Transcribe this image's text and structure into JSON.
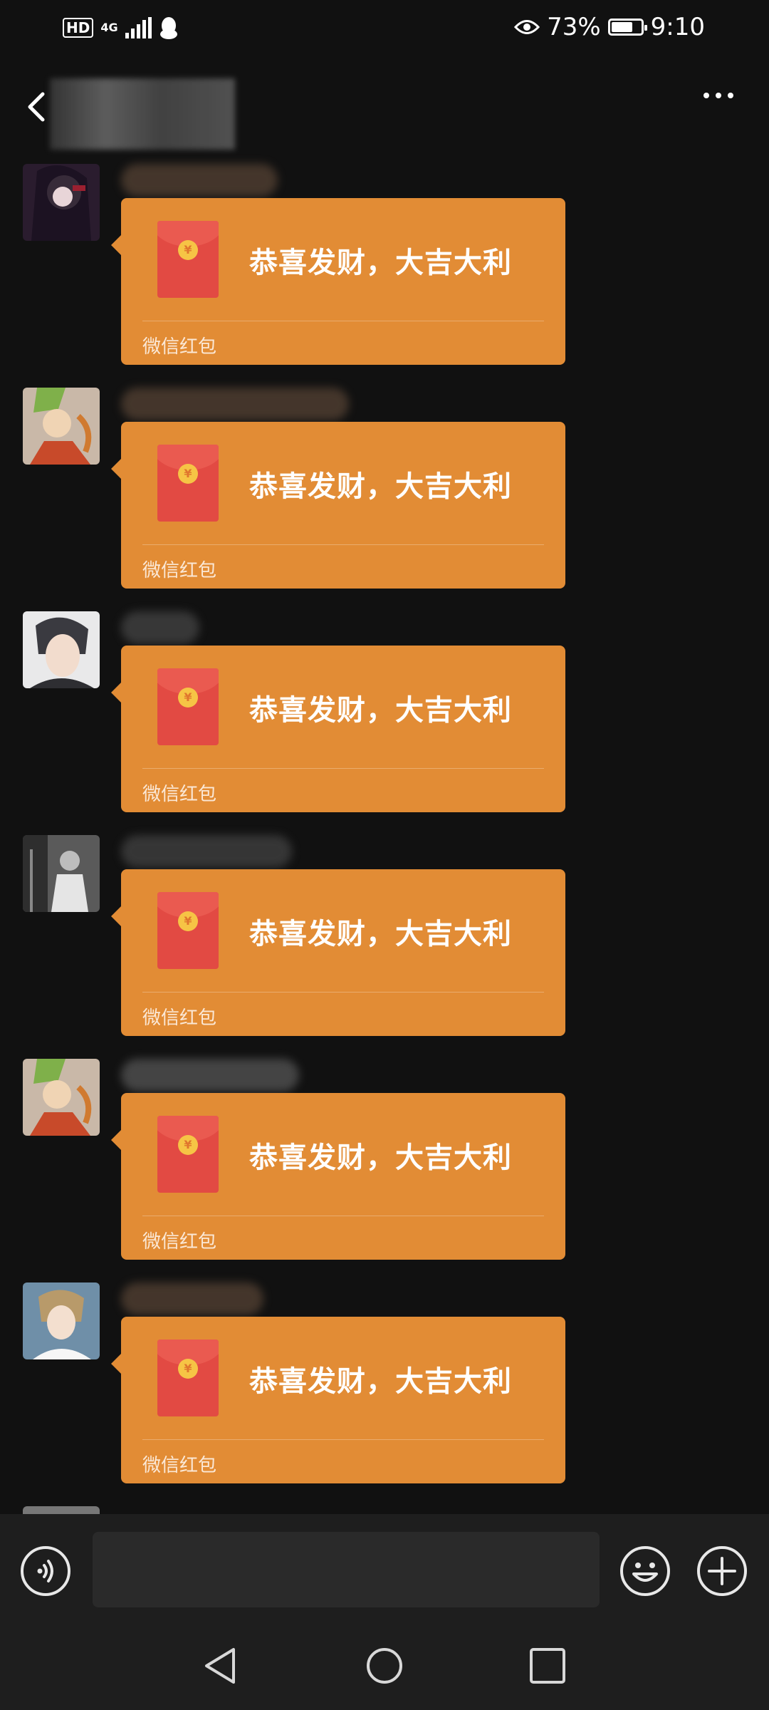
{
  "status_bar": {
    "hd": "HD",
    "network": "4G",
    "battery_percent": "73%",
    "battery_level": 0.73,
    "time": "9:10",
    "icons": [
      "hd-icon",
      "signal-icon",
      "qq-penguin-icon",
      "eye-icon",
      "battery-icon"
    ]
  },
  "header": {
    "back_icon": "chevron-left-icon",
    "more_icon": "more-dots-icon"
  },
  "messages": [
    {
      "greeting": "恭喜发财，大吉大利",
      "footer": "微信红包",
      "avatar": "anime-girl-dark"
    },
    {
      "greeting": "恭喜发财，大吉大利",
      "footer": "微信红包",
      "avatar": "green-hair-hero"
    },
    {
      "greeting": "恭喜发财，大吉大利",
      "footer": "微信红包",
      "avatar": "photo-young-man"
    },
    {
      "greeting": "恭喜发财，大吉大利",
      "footer": "微信红包",
      "avatar": "bw-photo"
    },
    {
      "greeting": "恭喜发财，大吉大利",
      "footer": "微信红包",
      "avatar": "green-hair-hero"
    },
    {
      "greeting": "恭喜发财，大吉大利",
      "footer": "微信红包",
      "avatar": "anime-boy-light"
    }
  ],
  "colors": {
    "background": "#111111",
    "bubble": "#e28c35",
    "envelope": "#e24a43",
    "coin": "#f6c445"
  },
  "input_bar": {
    "voice_icon": "voice-icon",
    "emoji_icon": "emoji-icon",
    "plus_icon": "plus-icon"
  },
  "nav_bar": {
    "icons": [
      "nav-back-icon",
      "nav-home-icon",
      "nav-recents-icon"
    ]
  }
}
